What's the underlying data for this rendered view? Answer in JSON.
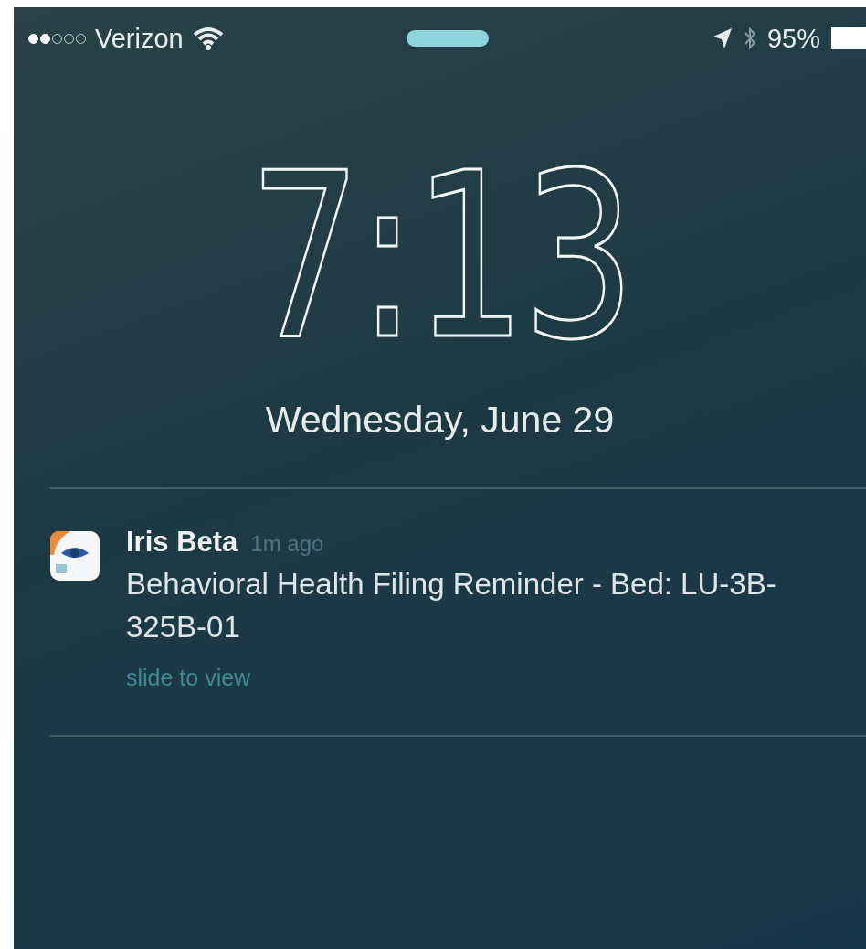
{
  "status_bar": {
    "carrier": "Verizon",
    "battery": "95%"
  },
  "lock_screen": {
    "time": "7:13",
    "date": "Wednesday, June 29"
  },
  "notifications": [
    {
      "app": "Iris Beta",
      "age": "1m ago",
      "message": "Behavioral Health Filing Reminder - Bed: LU-3B-325B-01",
      "action": "slide to view"
    }
  ]
}
